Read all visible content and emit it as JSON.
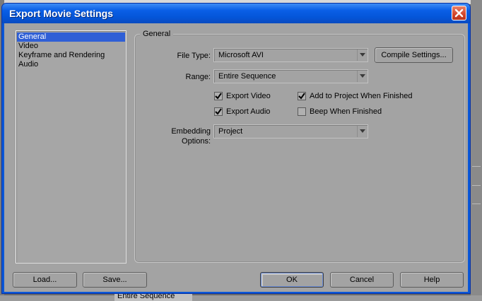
{
  "dialog": {
    "title": "Export Movie Settings",
    "close_icon": "close-icon"
  },
  "categories": [
    {
      "label": "General",
      "selected": true
    },
    {
      "label": "Video",
      "selected": false
    },
    {
      "label": "Keyframe and Rendering",
      "selected": false
    },
    {
      "label": "Audio",
      "selected": false
    }
  ],
  "general": {
    "legend": "General",
    "file_type_label": "File Type:",
    "file_type_value": "Microsoft AVI",
    "compile_settings_label": "Compile Settings...",
    "range_label": "Range:",
    "range_value": "Entire Sequence",
    "checkboxes": [
      {
        "label": "Export Video",
        "checked": true
      },
      {
        "label": "Add to Project When Finished",
        "checked": true
      },
      {
        "label": "Export Audio",
        "checked": true
      },
      {
        "label": "Beep When Finished",
        "checked": false
      }
    ],
    "embedding_label": "Embedding Options:",
    "embedding_value": "Project"
  },
  "buttons": {
    "load": "Load...",
    "save": "Save...",
    "ok": "OK",
    "cancel": "Cancel",
    "help": "Help"
  },
  "background": {
    "bottom_text": "Entire Sequence"
  },
  "colors": {
    "titlebar": "#0a5fe6",
    "selection": "#2f5fd6",
    "dialog_face": "#a3a3a3"
  }
}
